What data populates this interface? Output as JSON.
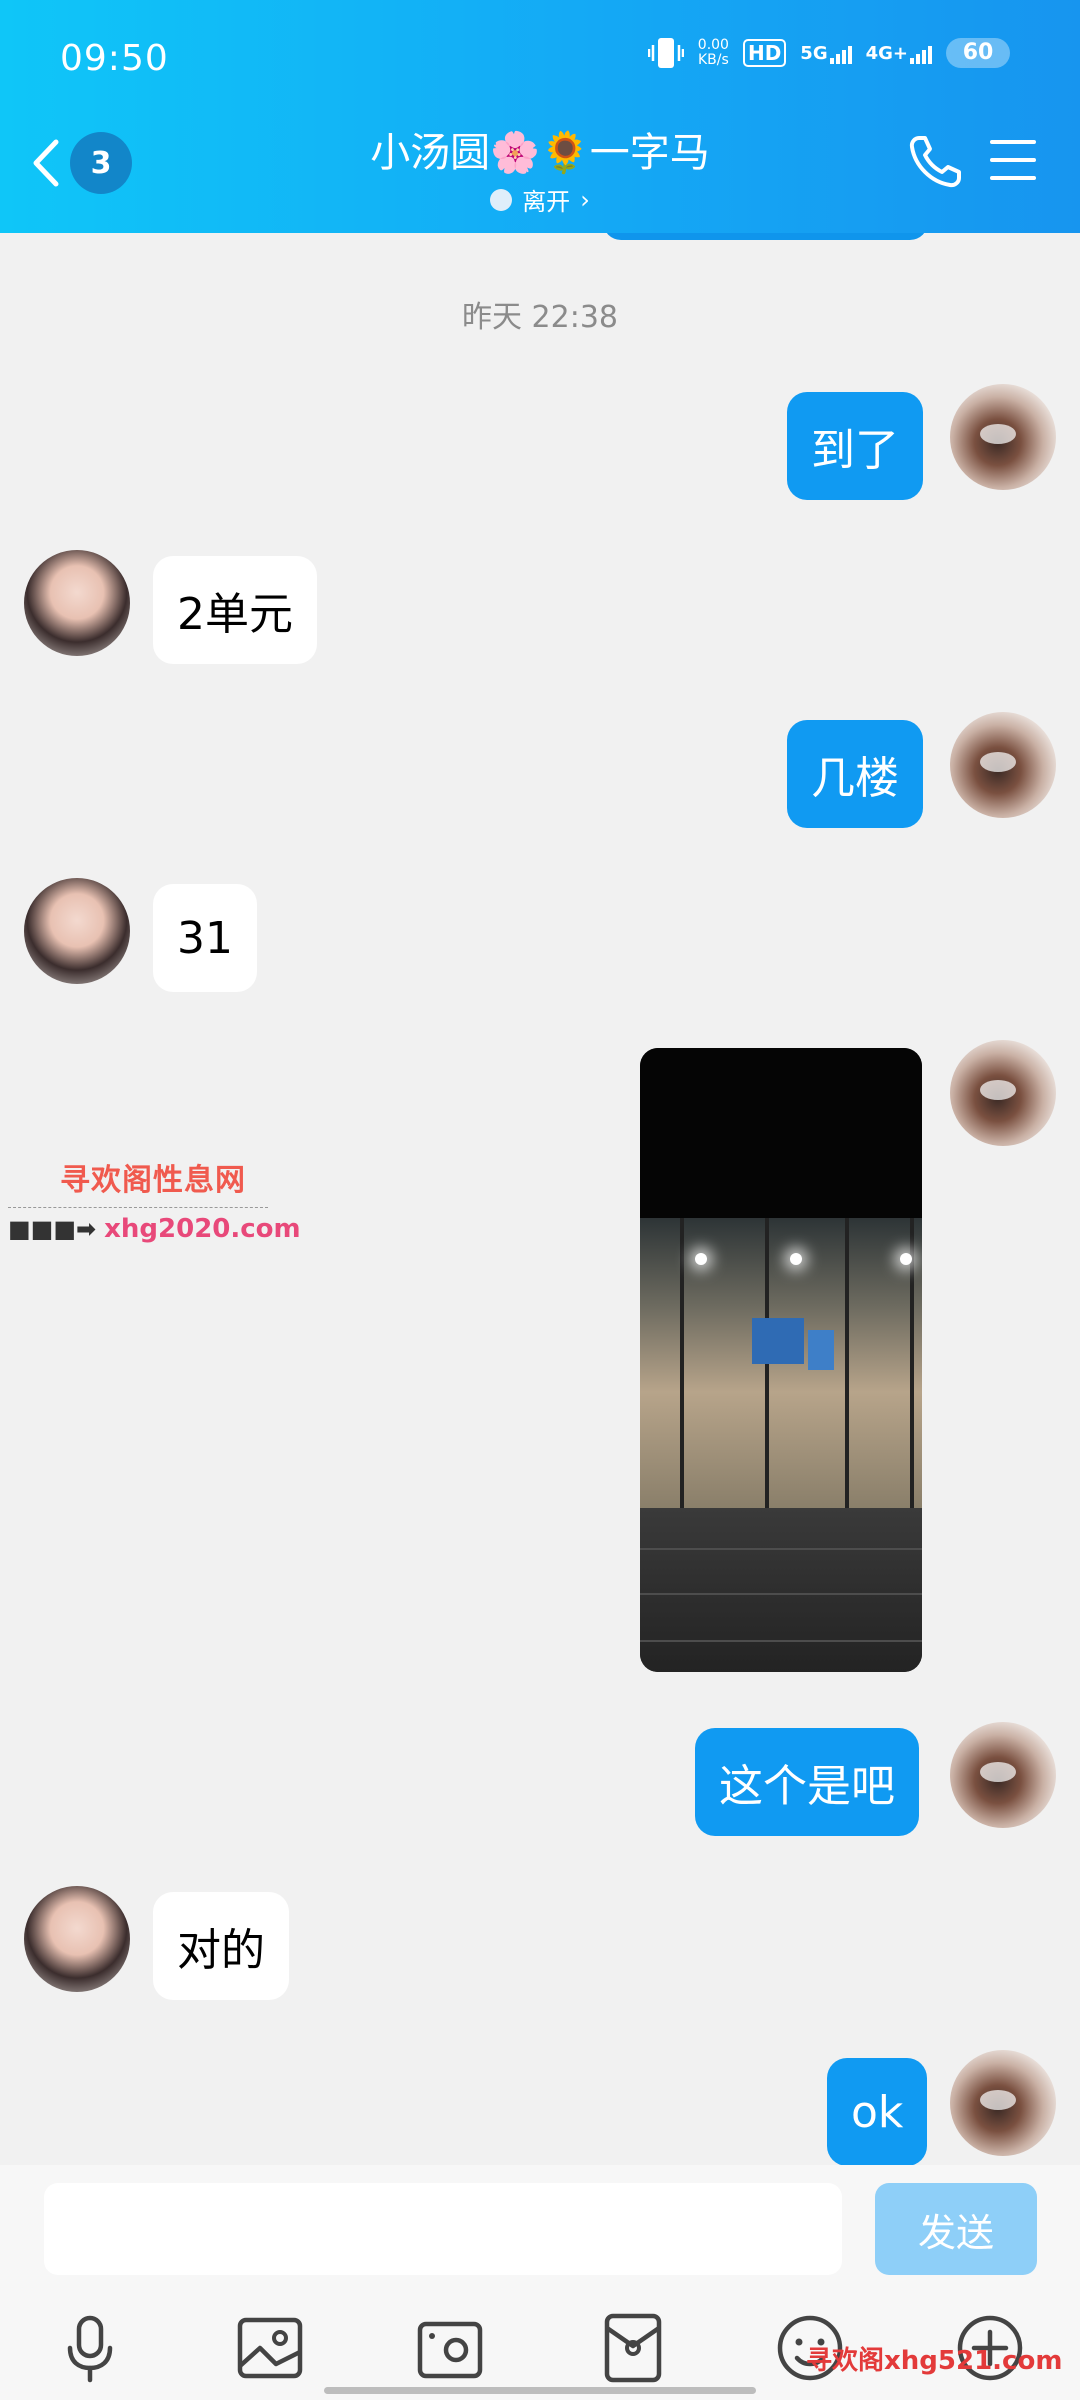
{
  "status_bar": {
    "time": "09:50",
    "net_speed_value": "0.00",
    "net_speed_unit": "KB/s",
    "hd_label": "HD",
    "sim1_network": "5G",
    "sim2_network": "4G+",
    "battery": "60"
  },
  "header": {
    "unread_count": "3",
    "title": "小汤圆🌸🌻一字马",
    "presence": "离开",
    "presence_chevron": "›"
  },
  "messages": {
    "timestamp": "昨天 22:38",
    "m1": "到了",
    "m2": "2单元",
    "m3": "几楼",
    "m4": "31",
    "m6": "这个是吧",
    "m7": "对的",
    "m8": "ok"
  },
  "watermark": {
    "title": "寻欢阁性息网",
    "arrow": "■■■➡",
    "url": "xhg2020.com",
    "bottom": "寻欢阁xhg521.com"
  },
  "input": {
    "placeholder": "",
    "send_label": "发送"
  },
  "toolbar": {
    "items": [
      "mic-icon",
      "image-icon",
      "camera-icon",
      "red-packet-icon",
      "emoji-icon",
      "plus-icon"
    ]
  },
  "colors": {
    "header_start": "#0fc6f8",
    "header_end": "#1795ef",
    "self_bubble": "#109af2",
    "send_button_disabled": "#8ecff8"
  }
}
